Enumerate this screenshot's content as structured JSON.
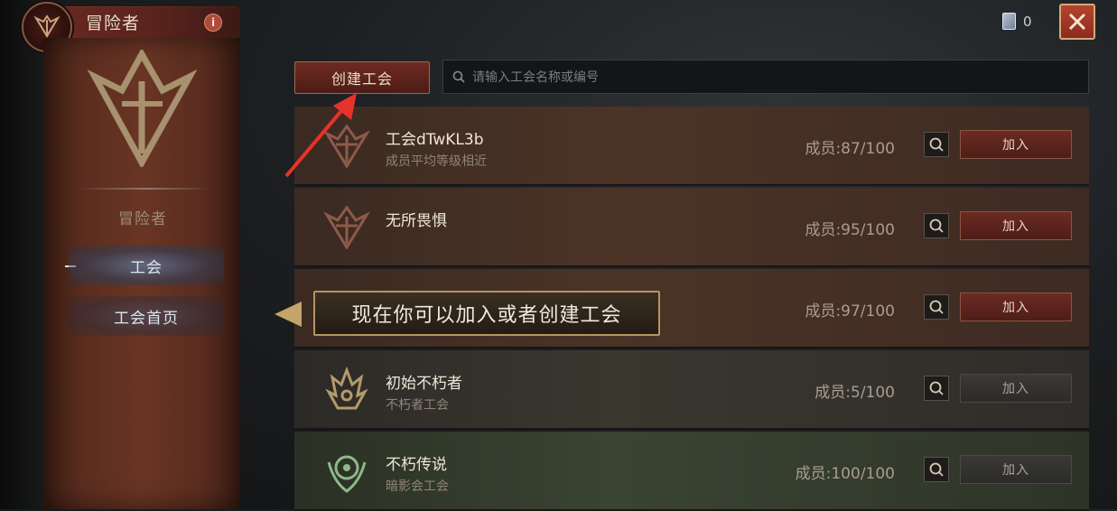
{
  "header": {
    "title": "冒险者",
    "info_icon_label": "i",
    "currency_value": "0",
    "close_icon": "close-icon"
  },
  "sidebar": {
    "subtitle": "冒险者",
    "items": [
      {
        "label": "工会",
        "active": true
      },
      {
        "label": "工会首页",
        "active": false
      }
    ]
  },
  "toolbar": {
    "create_label": "创建工会",
    "search_placeholder": "请输入工会名称或编号"
  },
  "guilds": [
    {
      "name": "工会dTwKL3b",
      "desc": "成员平均等级相近",
      "members": "成员:87/100",
      "join": "加入",
      "style": "brown",
      "join_style": "red"
    },
    {
      "name": "无所畏惧",
      "desc": "",
      "members": "成员:95/100",
      "join": "加入",
      "style": "brown",
      "join_style": "red"
    },
    {
      "name": "",
      "desc": "",
      "members": "成员:97/100",
      "join": "加入",
      "style": "brown",
      "join_style": "red"
    },
    {
      "name": "初始不朽者",
      "desc": "不朽者工会",
      "members": "成员:5/100",
      "join": "加入",
      "style": "gray",
      "join_style": "gray"
    },
    {
      "name": "不朽传说",
      "desc": "暗影会工会",
      "members": "成员:100/100",
      "join": "加入",
      "style": "green",
      "join_style": "gray"
    }
  ],
  "tooltip": {
    "text": "现在你可以加入或者创建工会"
  },
  "colors": {
    "accent_red": "#8b2b1f",
    "gold": "#b69463",
    "annotation_red": "#e8322a"
  }
}
